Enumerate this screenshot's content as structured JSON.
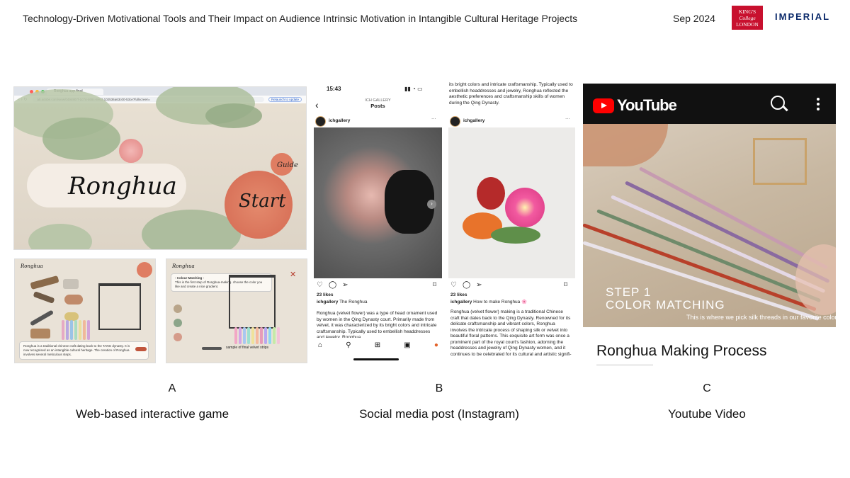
{
  "header": {
    "title": "Technology-Driven Motivational Tools and Their Impact on Audience Intrinsic Motivation in Intangible Cultural Heritage Projects",
    "date": "Sep 2024",
    "logo_kings": "KING'S College LONDON",
    "logo_imperial": "IMPERIAL"
  },
  "panel_a": {
    "browser_tab": "Ronghua app final",
    "url": "a5.adobe.com/view/0494907f-1c74-469c-8e63-102536a63c00-53ce?fullscreen=",
    "relaunch_label": "Relaunch to update",
    "game_title": "Ronghua",
    "start_label": "Start",
    "guide_label": "Guide",
    "thumb1_logo": "Ronghua",
    "thumb1_note": "Ronghua is a traditional chinese craft dating back to the TANG dynasty. It is now recognised as an intangible cultural heritage. The creation of Ronghua involves several meticulous steps.",
    "thumb2_logo": "Ronghua",
    "thumb2_note_title": "- Colour Matching -",
    "thumb2_note": "This is the first step of Ronghua-making. choose the color you like and create a nice gradient.",
    "thumb2_hint": "sample of final velvet strips",
    "letter": "A",
    "label": "Web-based interactive game"
  },
  "panel_b": {
    "status_time": "15:43",
    "header_small": "ICH GALLERY",
    "header_title": "Posts",
    "post1": {
      "username": "ichgallery",
      "likes": "23 likes",
      "caption_user": "ichgallery",
      "caption_title": "The Ronghua",
      "body": "Ronghua (velvet flower) was a type of head ornament used by women in the Qing Dynasty court. Primarily made from velvet, it was characterized by its bright colors and intricate craftsmanship. Typically used to embellish headdresses and jewelry. Ronghua"
    },
    "post2": {
      "top_text": "its bright colors and intricate craftsmanship. Typically used to embellish headdresses and jewelry, Ronghua reflected the aesthetic preferences and craftsmanship skills of women during the Qing Dynasty.",
      "username": "ichgallery",
      "likes": "23 likes",
      "caption_user": "ichgallery",
      "caption_title": "How to make Ronghua",
      "body": "Ronghua (velvet flower) making is a traditional Chinese craft that dates back to the Qing Dynasty. Renowned for its delicate craftsmanship and vibrant colors, Ronghua involves the intricate process of shaping silk or velvet into beautiful floral patterns. This exquisite art form was once a prominent part of the royal court's fashion, adorning the headdresses and jewelry of Qing Dynasty women, and it continues to be celebrated for its cultural and artistic signifi-"
    },
    "letter": "B",
    "label": "Social media post (Instagram)"
  },
  "panel_c": {
    "brand": "YouTube",
    "step_title": "STEP 1",
    "step_sub": "COLOR MATCHING",
    "caption": "This is where we pick silk threads in our favorite colors",
    "video_title": "Ronghua Making Process",
    "letter": "C",
    "label": "Youtube Video"
  }
}
